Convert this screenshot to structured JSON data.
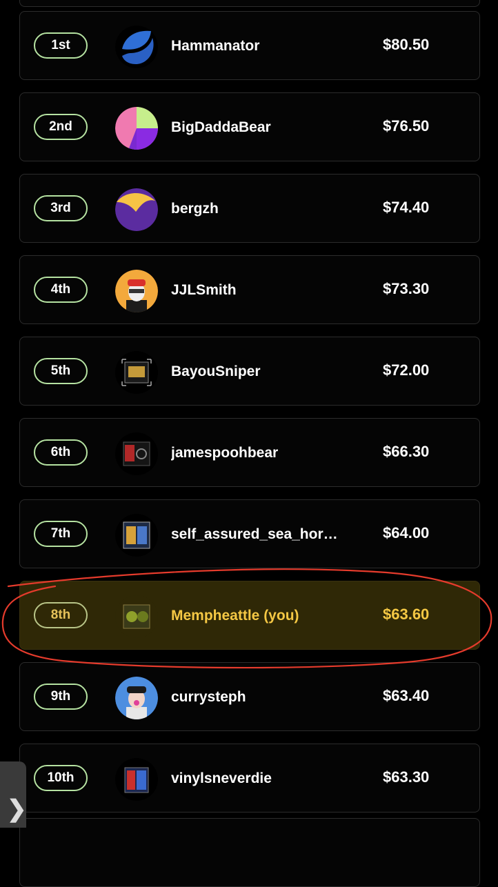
{
  "leaderboard": {
    "rows": [
      {
        "rank": "1st",
        "name": "Hammanator",
        "amount": "$80.50",
        "avatar": "blue-leaf-logo"
      },
      {
        "rank": "2nd",
        "name": "BigDaddaBear",
        "amount": "$76.50",
        "avatar": "pink-green-purple-circle"
      },
      {
        "rank": "3rd",
        "name": "bergzh",
        "amount": "$74.40",
        "avatar": "yellow-purple-circle"
      },
      {
        "rank": "4th",
        "name": "JJLSmith",
        "amount": "$73.30",
        "avatar": "cartoon-character-portrait"
      },
      {
        "rank": "5th",
        "name": "BayouSniper",
        "amount": "$72.00",
        "avatar": "card-cube-thumbnail"
      },
      {
        "rank": "6th",
        "name": "jamespoohbear",
        "amount": "$66.30",
        "avatar": "card-cube-thumbnail"
      },
      {
        "rank": "7th",
        "name": "self_assured_sea_hor…",
        "amount": "$64.00",
        "avatar": "card-cube-thumbnail"
      },
      {
        "rank": "8th",
        "name": "Mempheattle (you)",
        "amount": "$63.60",
        "avatar": "card-cube-thumbnail",
        "is_current_user": true
      },
      {
        "rank": "9th",
        "name": "currysteph",
        "amount": "$63.40",
        "avatar": "cartoon-character-portrait"
      },
      {
        "rank": "10th",
        "name": "vinylsneverdie",
        "amount": "$63.30",
        "avatar": "card-cube-thumbnail"
      }
    ]
  },
  "side_tab": {
    "icon": "chevron-right-icon",
    "glyph": "❯"
  },
  "colors": {
    "background": "#000000",
    "rank_pill_border": "#b6e3a2",
    "current_user_highlight": "#2f2806",
    "current_user_text": "#f5c844",
    "annotation_circle": "#e53b2c"
  }
}
